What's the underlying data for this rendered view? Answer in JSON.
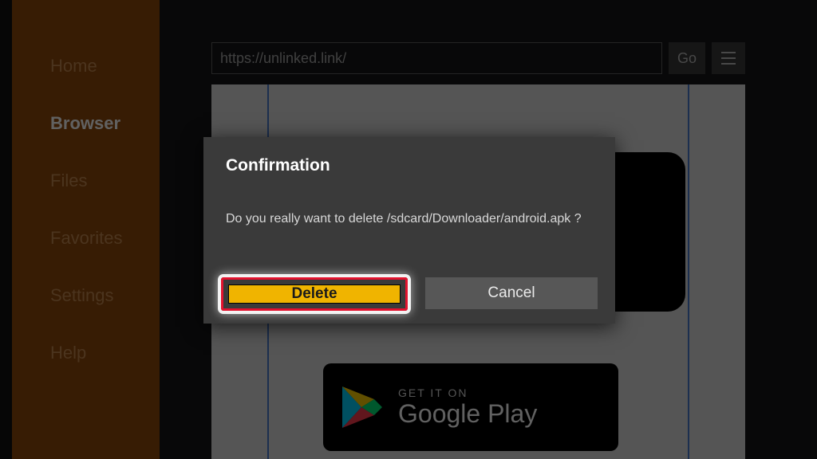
{
  "sidebar": {
    "items": [
      {
        "label": "Home"
      },
      {
        "label": "Browser"
      },
      {
        "label": "Files"
      },
      {
        "label": "Favorites"
      },
      {
        "label": "Settings"
      },
      {
        "label": "Help"
      }
    ],
    "active_index": 1
  },
  "toolbar": {
    "url_value": "https://unlinked.link/",
    "go_label": "Go"
  },
  "webpage": {
    "play_badge_line1": "GET IT ON",
    "play_badge_line2": "Google Play"
  },
  "dialog": {
    "title": "Confirmation",
    "message": "Do you really want to delete /sdcard/Downloader/android.apk ?",
    "delete_label": "Delete",
    "cancel_label": "Cancel"
  }
}
